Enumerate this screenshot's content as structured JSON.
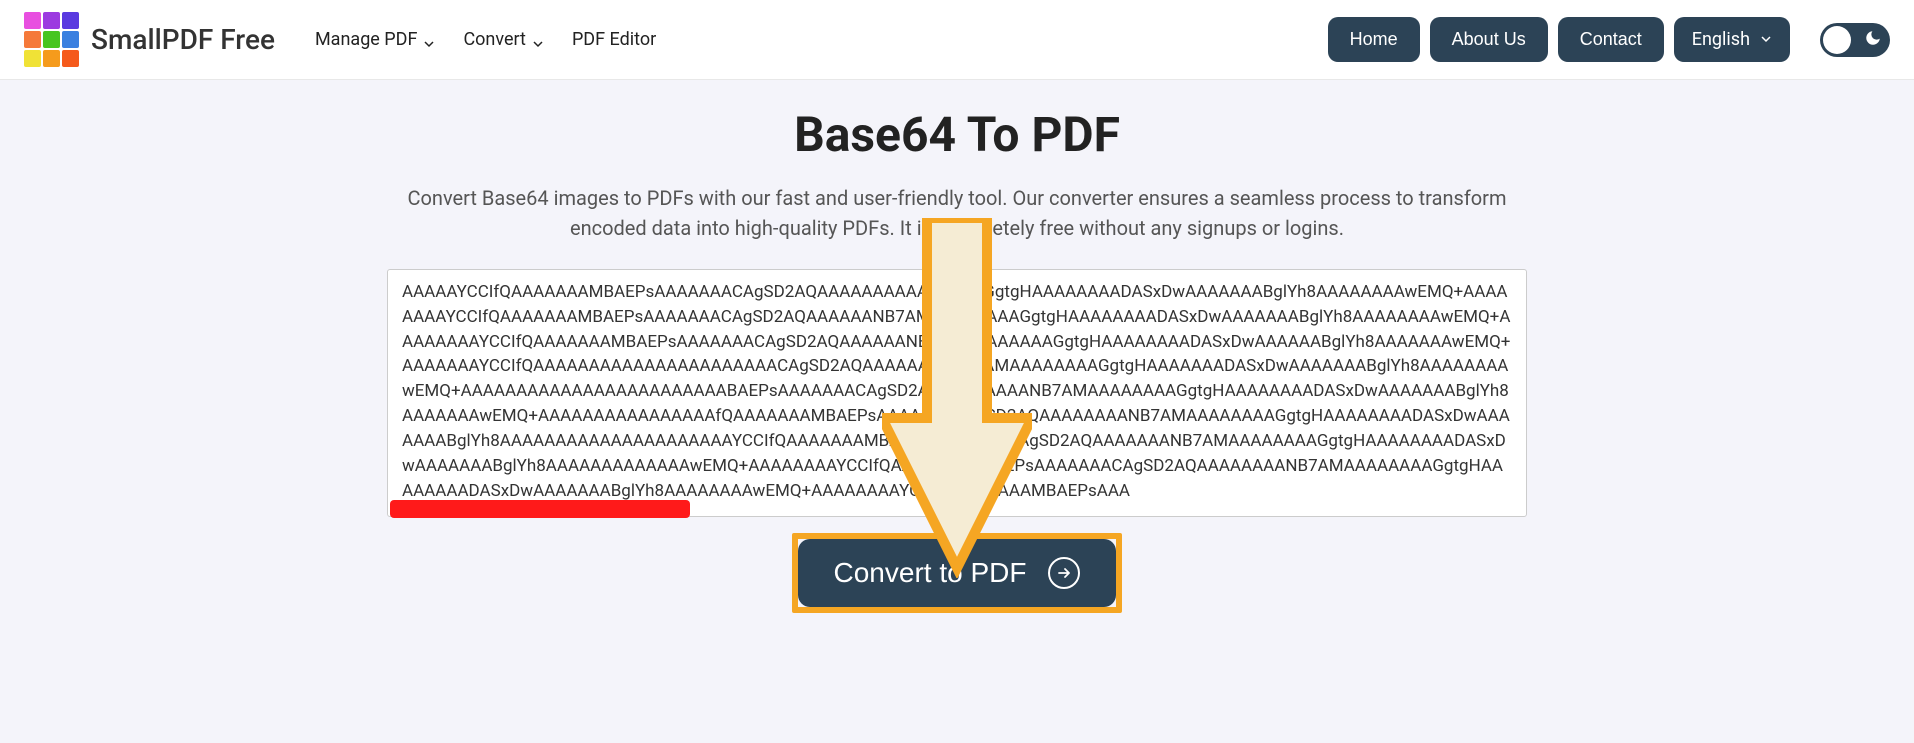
{
  "brand": "SmallPDF Free",
  "nav": {
    "manage": "Manage PDF",
    "convert": "Convert",
    "editor": "PDF Editor"
  },
  "header_buttons": {
    "home": "Home",
    "about": "About Us",
    "contact": "Contact"
  },
  "language": "English",
  "page": {
    "title": "Base64 To PDF",
    "subtitle": "Convert Base64 images to PDFs with our fast and user-friendly tool. Our converter ensures a seamless process to transform encoded data into high-quality PDFs. It is completely free without any signups or logins."
  },
  "textarea_value": "AAAAAYCCIfQAAAAAAAMBAEPsAAAAAAACAgSD2AQAAAAAAAAAAAAAAAGgtgHAAAAAAAADASxDwAAAAAAABglYh8AAAAAAAAwEMQ+AAAAAAAAYCCIfQAAAAAAAMBAEPsAAAAAAACAgSD2AQAAAAAANB7AMAAAAAAAAGgtgHAAAAAAAADASxDwAAAAAAABglYh8AAAAAAAAwEMQ+AAAAAAAAYCCIfQAAAAAAAMBAEPsAAAAAAACAgSD2AQAAAAAANB7AMAAAAAAAAGgtgHAAAAAAAADASxDwAAAAAABglYh8AAAAAAAwEMQ+AAAAAAAYCCIfQAAAAAAAAAAAAAAAAAAAAAACAgSD2AQAAAAAAAANB7AMAAAAAAAAGgtgHAAAAAAADASxDwAAAAAAABglYh8AAAAAAAAwEMQ+AAAAAAAAAAAAAAAAAAAAAAAABAEPsAAAAAAACAgSD2AQAAAAAAAANB7AMAAAAAAAAGgtgHAAAAAAAADASxDwAAAAAAABglYh8AAAAAAAwEMQ+AAAAAAAAAAAAAAAAfQAAAAAAAMBAEPsAAAAAAACAgSD2AQAAAAAAAANB7AMAAAAAAAAGgtgHAAAAAAAADASxDwAAAAAAABglYh8AAAAAAAAAAAAAAAAAAAAAYCCIfQAAAAAAAMBAEPsAAAAAAACAgSD2AQAAAAAAANB7AMAAAAAAAAGgtgHAAAAAAAADASxDwAAAAAAABglYh8AAAAAAAAAAAAAwEMQ+AAAAAAAAYCCIfQAAAAAAAMBAEPsAAAAAAACAgSD2AQAAAAAAAANB7AMAAAAAAAAGgtgHAAAAAAAADASxDwAAAAAAABglYh8AAAAAAAAwEMQ+AAAAAAAAYCCIfQAAAAAAAMBAEPsAAA",
  "convert_button": "Convert to PDF"
}
